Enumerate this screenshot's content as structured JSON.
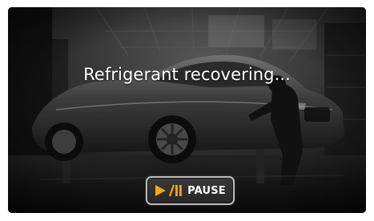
{
  "status": {
    "message": "Refrigerant recovering..."
  },
  "controls": {
    "pause_label": "PAUSE",
    "pause_icon": "play-pause-icon",
    "icon_color": "#f2a71b"
  },
  "background": {
    "scene": "background-photo"
  }
}
